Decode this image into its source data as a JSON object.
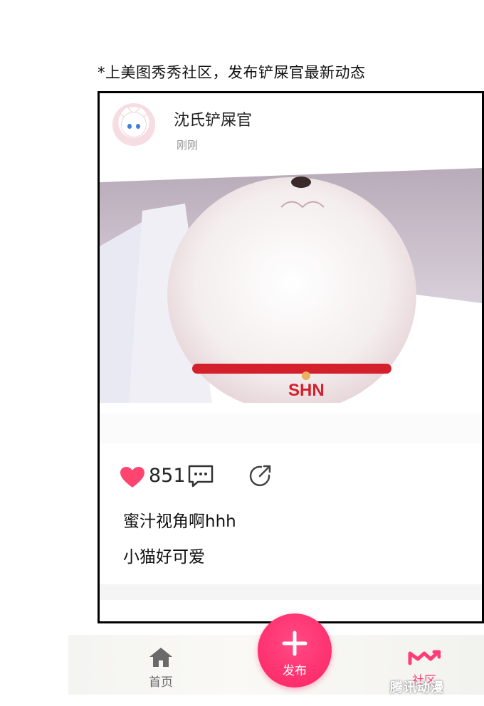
{
  "caption": "*上美图秀秀社区，发布铲屎官最新动态",
  "post": {
    "username": "沈氏铲屎官",
    "time": "刚刚",
    "likes": "851",
    "text_lines": [
      "蜜汁视角啊hhh",
      "小猫好可爱"
    ]
  },
  "tabbar": {
    "home_label": "首页",
    "publish_label": "发布",
    "community_label": "社区"
  },
  "watermark": "腾讯动漫",
  "colors": {
    "accent": "#ff2f6d",
    "like_heart": "#ff4470",
    "community_active": "#ff3c7a"
  },
  "icons": {
    "heart": "heart-icon",
    "comment": "comment-icon",
    "share": "share-icon",
    "home": "home-icon",
    "community": "community-icon",
    "plus": "plus-icon"
  }
}
